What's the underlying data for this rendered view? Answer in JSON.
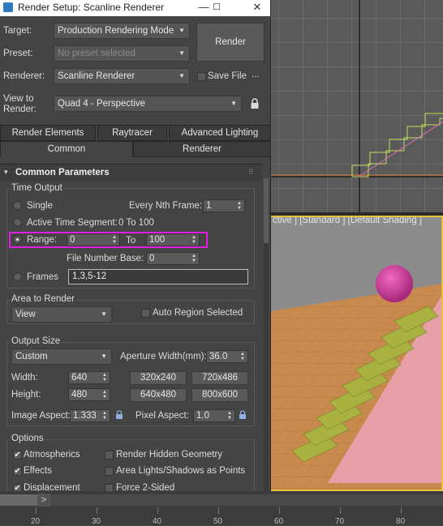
{
  "window": {
    "title": "Render Setup: Scanline Renderer",
    "minimize": "—",
    "maximize": "☐",
    "close": "✕"
  },
  "header": {
    "target_label": "Target:",
    "target_value": "Production Rendering Mode",
    "preset_label": "Preset:",
    "preset_value": "No preset selected",
    "renderer_label": "Renderer:",
    "renderer_value": "Scanline Renderer",
    "save_file_label": "Save File",
    "more": "...",
    "view_label_1": "View to",
    "view_label_2": "Render:",
    "view_value": "Quad 4 - Perspective",
    "render_button": "Render"
  },
  "tabs": {
    "row1": [
      "Render Elements",
      "Raytracer",
      "Advanced Lighting"
    ],
    "row2": [
      "Common",
      "Renderer"
    ]
  },
  "rollout": {
    "title": "Common Parameters",
    "expand_glyph": "▾",
    "grip": "⠿"
  },
  "time_output": {
    "title": "Time Output",
    "single": "Single",
    "every_nth_label": "Every Nth Frame:",
    "every_nth_value": "1",
    "active_segment": "Active Time Segment:",
    "active_segment_range": "0 To 100",
    "range_label": "Range:",
    "range_from": "0",
    "to_label": "To",
    "range_to": "100",
    "file_number_base_label": "File Number Base:",
    "file_number_base_value": "0",
    "frames_label": "Frames",
    "frames_value": "1,3,5-12"
  },
  "area_to_render": {
    "title": "Area to Render",
    "value": "View",
    "auto_region": "Auto Region Selected"
  },
  "output_size": {
    "title": "Output Size",
    "preset": "Custom",
    "aperture_label": "Aperture Width(mm):",
    "aperture_value": "36.0",
    "width_label": "Width:",
    "width_value": "640",
    "height_label": "Height:",
    "height_value": "480",
    "presets": [
      "320x240",
      "720x486",
      "640x480",
      "800x600"
    ],
    "image_aspect_label": "Image Aspect:",
    "image_aspect_value": "1.333",
    "pixel_aspect_label": "Pixel Aspect:",
    "pixel_aspect_value": "1.0"
  },
  "options": {
    "title": "Options",
    "atmospherics": "Atmospherics",
    "render_hidden": "Render Hidden Geometry",
    "effects": "Effects",
    "area_lights": "Area Lights/Shadows as Points",
    "displacement": "Displacement",
    "force_2sided": "Force 2-Sided",
    "check_glyph": "✔"
  },
  "viewport": {
    "label": "ctive ] [Standard ] [Default Shading ]"
  },
  "timeline": {
    "arrow": ">",
    "ticks": [
      "20",
      "30",
      "40",
      "50",
      "60",
      "70",
      "80"
    ]
  },
  "colors": {
    "highlight": "#e020e0",
    "active_border": "#e9c23d"
  }
}
